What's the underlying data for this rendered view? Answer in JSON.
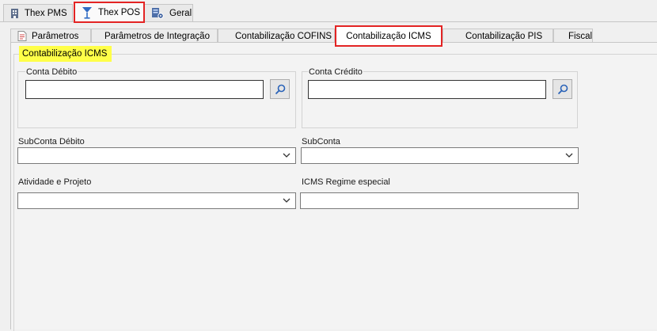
{
  "top_tabs": [
    {
      "label": "Thex PMS",
      "icon": "building-icon"
    },
    {
      "label": "Thex POS",
      "icon": "cocktail-glass-icon",
      "active": true
    },
    {
      "label": "Geral",
      "icon": "server-settings-icon"
    }
  ],
  "sub_tabs": [
    {
      "label": "Parâmetros",
      "icon": "document-icon"
    },
    {
      "label": "Parâmetros de Integração"
    },
    {
      "label": "Contabilização COFINS"
    },
    {
      "label": "Contabilização ICMS",
      "active": true
    },
    {
      "label": "Contabilização PIS"
    },
    {
      "label": "Fiscal"
    }
  ],
  "section": {
    "title": "Contabilização ICMS"
  },
  "conta_debito": {
    "label": "Conta Débito",
    "value": ""
  },
  "conta_credito": {
    "label": "Conta Crédito",
    "value": ""
  },
  "subconta_debito": {
    "label": "SubConta Débito",
    "value": ""
  },
  "subconta": {
    "label": "SubConta",
    "value": ""
  },
  "atividade_projeto": {
    "label": "Atividade e Projeto",
    "value": ""
  },
  "icms_regime": {
    "label": "ICMS Regime especial",
    "value": ""
  },
  "colors": {
    "highlight": "#ffff48",
    "annotation_red": "#e32424"
  }
}
